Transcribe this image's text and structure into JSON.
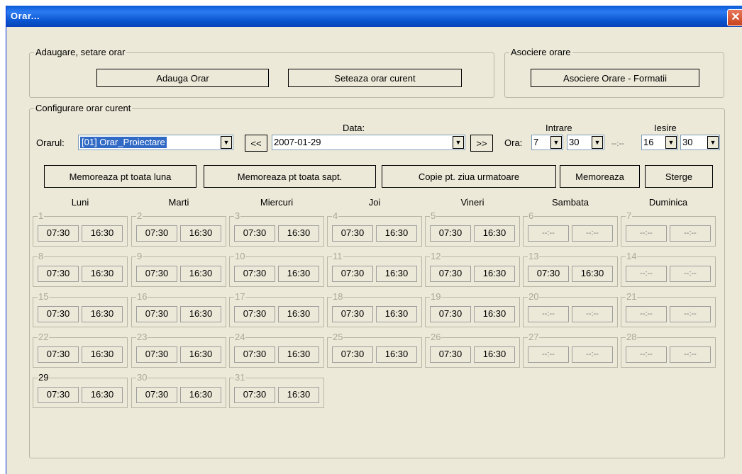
{
  "window": {
    "title": "Orar...",
    "close_icon": "close-icon"
  },
  "group_add": {
    "label": "Adaugare, setare orar",
    "add_button": "Adauga Orar",
    "set_current_button": "Seteaza orar curent"
  },
  "group_assoc": {
    "label": "Asociere orare",
    "assoc_button": "Asociere Orare - Formatii"
  },
  "group_config": {
    "label": "Configurare orar curent",
    "orar_label": "Orarul:",
    "orar_value": "[01] Orar_Proiectare",
    "data_label": "Data:",
    "prev_button": "<<",
    "date_value": "2007-01-29",
    "next_button": ">>",
    "intrare_label": "Intrare",
    "iesire_label": "Iesire",
    "ora_label": "Ora:",
    "in_hour": "7",
    "in_min": "30",
    "separator": "--:--",
    "out_hour": "16",
    "out_min": "30",
    "buttons": {
      "month": "Memoreaza pt toata luna",
      "week": "Memoreaza pt toata sapt.",
      "copy": "Copie pt. ziua urmatoare",
      "save": "Memoreaza",
      "delete": "Sterge"
    },
    "weekdays": [
      "Luni",
      "Marti",
      "Miercuri",
      "Joi",
      "Vineri",
      "Sambata",
      "Duminica"
    ],
    "days": [
      {
        "n": "1",
        "in": "07:30",
        "out": "16:30"
      },
      {
        "n": "2",
        "in": "07:30",
        "out": "16:30"
      },
      {
        "n": "3",
        "in": "07:30",
        "out": "16:30"
      },
      {
        "n": "4",
        "in": "07:30",
        "out": "16:30"
      },
      {
        "n": "5",
        "in": "07:30",
        "out": "16:30"
      },
      {
        "n": "6",
        "in": "--:--",
        "out": "--:--"
      },
      {
        "n": "7",
        "in": "--:--",
        "out": "--:--"
      },
      {
        "n": "8",
        "in": "07:30",
        "out": "16:30"
      },
      {
        "n": "9",
        "in": "07:30",
        "out": "16:30"
      },
      {
        "n": "10",
        "in": "07:30",
        "out": "16:30"
      },
      {
        "n": "11",
        "in": "07:30",
        "out": "16:30"
      },
      {
        "n": "12",
        "in": "07:30",
        "out": "16:30"
      },
      {
        "n": "13",
        "in": "07:30",
        "out": "16:30"
      },
      {
        "n": "14",
        "in": "--:--",
        "out": "--:--"
      },
      {
        "n": "15",
        "in": "07:30",
        "out": "16:30"
      },
      {
        "n": "16",
        "in": "07:30",
        "out": "16:30"
      },
      {
        "n": "17",
        "in": "07:30",
        "out": "16:30"
      },
      {
        "n": "18",
        "in": "07:30",
        "out": "16:30"
      },
      {
        "n": "19",
        "in": "07:30",
        "out": "16:30"
      },
      {
        "n": "20",
        "in": "--:--",
        "out": "--:--"
      },
      {
        "n": "21",
        "in": "--:--",
        "out": "--:--"
      },
      {
        "n": "22",
        "in": "07:30",
        "out": "16:30"
      },
      {
        "n": "23",
        "in": "07:30",
        "out": "16:30"
      },
      {
        "n": "24",
        "in": "07:30",
        "out": "16:30"
      },
      {
        "n": "25",
        "in": "07:30",
        "out": "16:30"
      },
      {
        "n": "26",
        "in": "07:30",
        "out": "16:30"
      },
      {
        "n": "27",
        "in": "--:--",
        "out": "--:--"
      },
      {
        "n": "28",
        "in": "--:--",
        "out": "--:--"
      },
      {
        "n": "29",
        "in": "07:30",
        "out": "16:30",
        "active": true
      },
      {
        "n": "30",
        "in": "07:30",
        "out": "16:30"
      },
      {
        "n": "31",
        "in": "07:30",
        "out": "16:30"
      }
    ]
  }
}
